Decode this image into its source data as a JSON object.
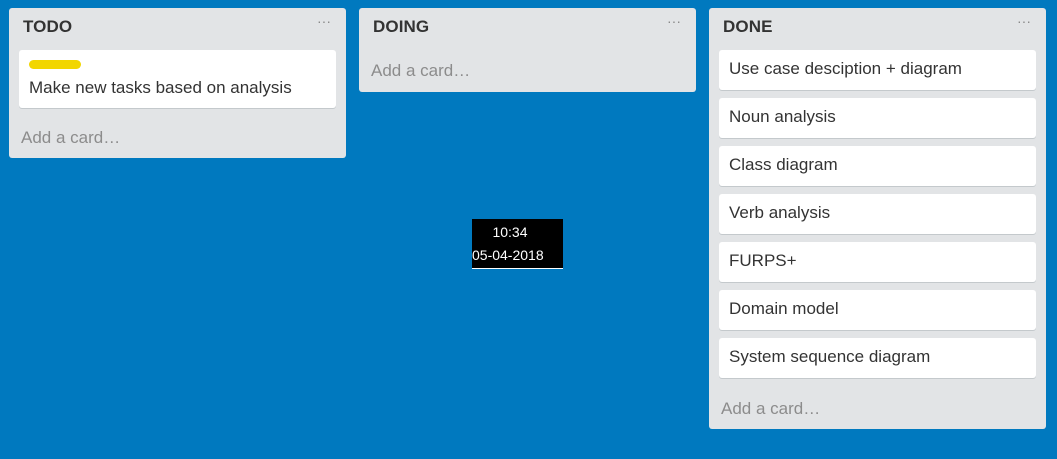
{
  "board": {
    "background_color": "#0079bf",
    "lists": [
      {
        "title": "TODO",
        "menu_icon": "ellipsis-icon",
        "menu_glyph": "···",
        "cards": [
          {
            "text": "Make new tasks based on analysis",
            "label_color": "#f2d600"
          }
        ],
        "add_card": "Add a card…"
      },
      {
        "title": "DOING",
        "menu_icon": "ellipsis-icon",
        "menu_glyph": "···",
        "cards": [],
        "add_card": "Add a card…"
      },
      {
        "title": "DONE",
        "menu_icon": "ellipsis-icon",
        "menu_glyph": "···",
        "cards": [
          {
            "text": "Use case desciption + diagram"
          },
          {
            "text": "Noun analysis"
          },
          {
            "text": "Class diagram"
          },
          {
            "text": "Verb analysis"
          },
          {
            "text": "FURPS+"
          },
          {
            "text": "Domain model"
          },
          {
            "text": "System sequence diagram"
          }
        ],
        "add_card": "Add a card…"
      }
    ]
  },
  "clock": {
    "time": "10:34",
    "date": "05-04-2018"
  }
}
